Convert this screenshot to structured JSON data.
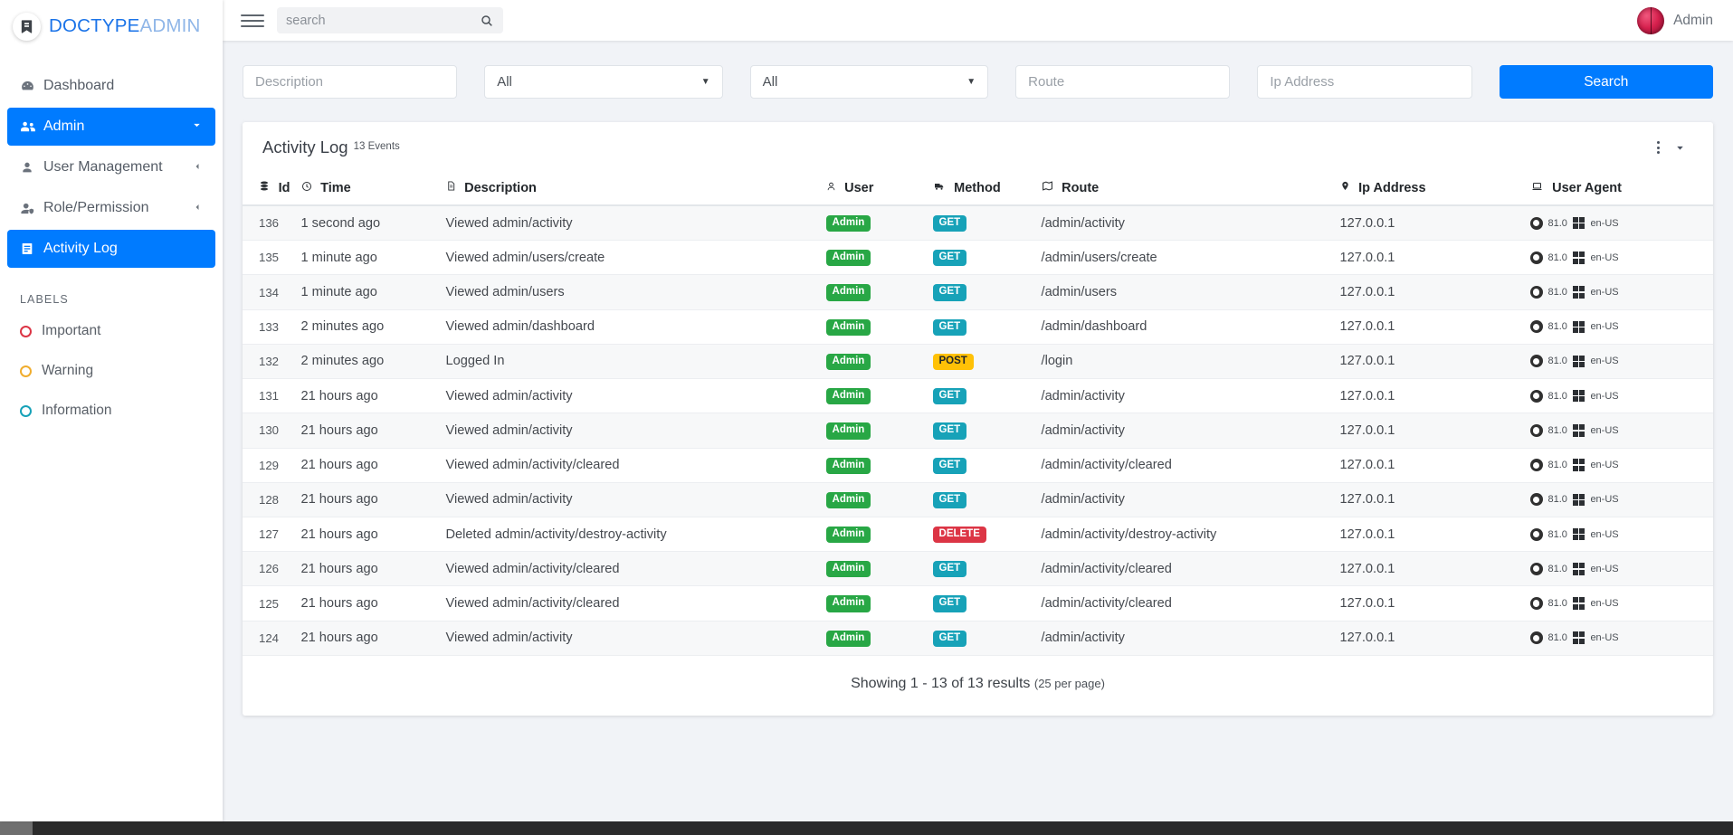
{
  "brand": {
    "name_primary": "DOCTYPE",
    "name_secondary": "ADMIN",
    "logo_icon": "app-logo-icon"
  },
  "sidebar": {
    "items": [
      {
        "label": "Dashboard",
        "icon": "dashboard-icon",
        "active": false,
        "caret": ""
      },
      {
        "label": "Admin",
        "icon": "admin-users-icon",
        "active": true,
        "caret": "⌄"
      },
      {
        "label": "User Management",
        "icon": "user-icon",
        "active": false,
        "caret": "‹"
      },
      {
        "label": "Role/Permission",
        "icon": "user-shield-icon",
        "active": false,
        "caret": "‹"
      },
      {
        "label": "Activity Log",
        "icon": "activity-log-icon",
        "active": true,
        "caret": ""
      }
    ],
    "labels_title": "LABELS",
    "labels": [
      {
        "label": "Important",
        "color": "#dc3545"
      },
      {
        "label": "Warning",
        "color": "#f0ad2e"
      },
      {
        "label": "Information",
        "color": "#17a2b8"
      }
    ]
  },
  "topbar": {
    "menu_icon": "hamburger-menu-icon",
    "search_placeholder": "search",
    "search_value": "",
    "search_icon": "search-icon",
    "user_name": "Admin",
    "avatar_icon": "avatar"
  },
  "filters": {
    "description_placeholder": "Description",
    "description_value": "",
    "user_select_value": "All",
    "method_select_value": "All",
    "route_placeholder": "Route",
    "route_value": "",
    "ip_placeholder": "Ip Address",
    "ip_value": "",
    "search_button": "Search"
  },
  "card": {
    "title": "Activity Log",
    "subtitle_count": "13",
    "subtitle_unit": "Events",
    "menu_icon": "kebab-menu-icon",
    "dropdown_icon": "chevron-down-icon"
  },
  "table": {
    "columns": [
      {
        "label": "Id",
        "icon": "database-icon"
      },
      {
        "label": "Time",
        "icon": "clock-icon"
      },
      {
        "label": "Description",
        "icon": "file-text-icon"
      },
      {
        "label": "User",
        "icon": "user-icon"
      },
      {
        "label": "Method",
        "icon": "truck-icon"
      },
      {
        "label": "Route",
        "icon": "map-icon"
      },
      {
        "label": "Ip Address",
        "icon": "map-pin-icon"
      },
      {
        "label": "User Agent",
        "icon": "laptop-icon"
      }
    ],
    "rows": [
      {
        "id": "136",
        "time": "1 second ago",
        "description": "Viewed admin/activity",
        "user": "Admin",
        "method": "GET",
        "route": "/admin/activity",
        "ip": "127.0.0.1",
        "browser": "Chrome",
        "version": "81.0",
        "os": "Windows",
        "lang": "en-US"
      },
      {
        "id": "135",
        "time": "1 minute ago",
        "description": "Viewed admin/users/create",
        "user": "Admin",
        "method": "GET",
        "route": "/admin/users/create",
        "ip": "127.0.0.1",
        "browser": "Chrome",
        "version": "81.0",
        "os": "Windows",
        "lang": "en-US"
      },
      {
        "id": "134",
        "time": "1 minute ago",
        "description": "Viewed admin/users",
        "user": "Admin",
        "method": "GET",
        "route": "/admin/users",
        "ip": "127.0.0.1",
        "browser": "Chrome",
        "version": "81.0",
        "os": "Windows",
        "lang": "en-US"
      },
      {
        "id": "133",
        "time": "2 minutes ago",
        "description": "Viewed admin/dashboard",
        "user": "Admin",
        "method": "GET",
        "route": "/admin/dashboard",
        "ip": "127.0.0.1",
        "browser": "Chrome",
        "version": "81.0",
        "os": "Windows",
        "lang": "en-US"
      },
      {
        "id": "132",
        "time": "2 minutes ago",
        "description": "Logged In",
        "user": "Admin",
        "method": "POST",
        "route": "/login",
        "ip": "127.0.0.1",
        "browser": "Chrome",
        "version": "81.0",
        "os": "Windows",
        "lang": "en-US"
      },
      {
        "id": "131",
        "time": "21 hours ago",
        "description": "Viewed admin/activity",
        "user": "Admin",
        "method": "GET",
        "route": "/admin/activity",
        "ip": "127.0.0.1",
        "browser": "Chrome",
        "version": "81.0",
        "os": "Windows",
        "lang": "en-US"
      },
      {
        "id": "130",
        "time": "21 hours ago",
        "description": "Viewed admin/activity",
        "user": "Admin",
        "method": "GET",
        "route": "/admin/activity",
        "ip": "127.0.0.1",
        "browser": "Chrome",
        "version": "81.0",
        "os": "Windows",
        "lang": "en-US"
      },
      {
        "id": "129",
        "time": "21 hours ago",
        "description": "Viewed admin/activity/cleared",
        "user": "Admin",
        "method": "GET",
        "route": "/admin/activity/cleared",
        "ip": "127.0.0.1",
        "browser": "Chrome",
        "version": "81.0",
        "os": "Windows",
        "lang": "en-US"
      },
      {
        "id": "128",
        "time": "21 hours ago",
        "description": "Viewed admin/activity",
        "user": "Admin",
        "method": "GET",
        "route": "/admin/activity",
        "ip": "127.0.0.1",
        "browser": "Chrome",
        "version": "81.0",
        "os": "Windows",
        "lang": "en-US"
      },
      {
        "id": "127",
        "time": "21 hours ago",
        "description": "Deleted admin/activity/destroy-activity",
        "user": "Admin",
        "method": "DELETE",
        "route": "/admin/activity/destroy-activity",
        "ip": "127.0.0.1",
        "browser": "Chrome",
        "version": "81.0",
        "os": "Windows",
        "lang": "en-US"
      },
      {
        "id": "126",
        "time": "21 hours ago",
        "description": "Viewed admin/activity/cleared",
        "user": "Admin",
        "method": "GET",
        "route": "/admin/activity/cleared",
        "ip": "127.0.0.1",
        "browser": "Chrome",
        "version": "81.0",
        "os": "Windows",
        "lang": "en-US"
      },
      {
        "id": "125",
        "time": "21 hours ago",
        "description": "Viewed admin/activity/cleared",
        "user": "Admin",
        "method": "GET",
        "route": "/admin/activity/cleared",
        "ip": "127.0.0.1",
        "browser": "Chrome",
        "version": "81.0",
        "os": "Windows",
        "lang": "en-US"
      },
      {
        "id": "124",
        "time": "21 hours ago",
        "description": "Viewed admin/activity",
        "user": "Admin",
        "method": "GET",
        "route": "/admin/activity",
        "ip": "127.0.0.1",
        "browser": "Chrome",
        "version": "81.0",
        "os": "Windows",
        "lang": "en-US"
      }
    ],
    "footer_main": "Showing 1 - 13 of 13 results",
    "footer_per_page": "(25 per page)"
  },
  "colors": {
    "accent": "#007bff",
    "success": "#28a745",
    "info": "#17a2b8",
    "warning": "#ffc107",
    "danger": "#dc3545",
    "page_bg": "#f1f3f7"
  }
}
